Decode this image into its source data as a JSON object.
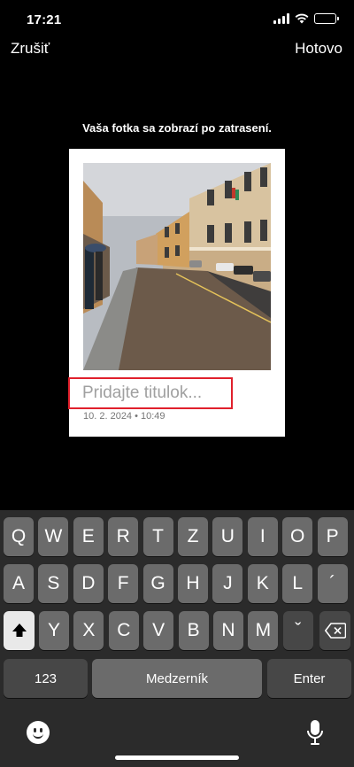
{
  "status": {
    "time": "17:21"
  },
  "nav": {
    "cancel_label": "Zrušiť",
    "done_label": "Hotovo"
  },
  "hint": "Vaša fotka sa zobrazí po zatrasení.",
  "polaroid": {
    "caption_placeholder": "Pridajte titulok...",
    "date": "10. 2. 2024 • 10:49"
  },
  "keyboard": {
    "row1": [
      "Q",
      "W",
      "E",
      "R",
      "T",
      "Z",
      "U",
      "I",
      "O",
      "P"
    ],
    "row2": [
      "A",
      "S",
      "D",
      "F",
      "G",
      "H",
      "J",
      "K",
      "L",
      "´"
    ],
    "row3": [
      "Y",
      "X",
      "C",
      "V",
      "B",
      "N",
      "M",
      "ˇ"
    ],
    "numbers_label": "123",
    "space_label": "Medzerník",
    "enter_label": "Enter"
  },
  "icons": {
    "signal": "signal-icon",
    "wifi": "wifi-icon",
    "battery": "battery-icon",
    "shift": "shift-icon",
    "backspace": "backspace-icon",
    "emoji": "emoji-icon",
    "mic": "microphone-icon"
  }
}
